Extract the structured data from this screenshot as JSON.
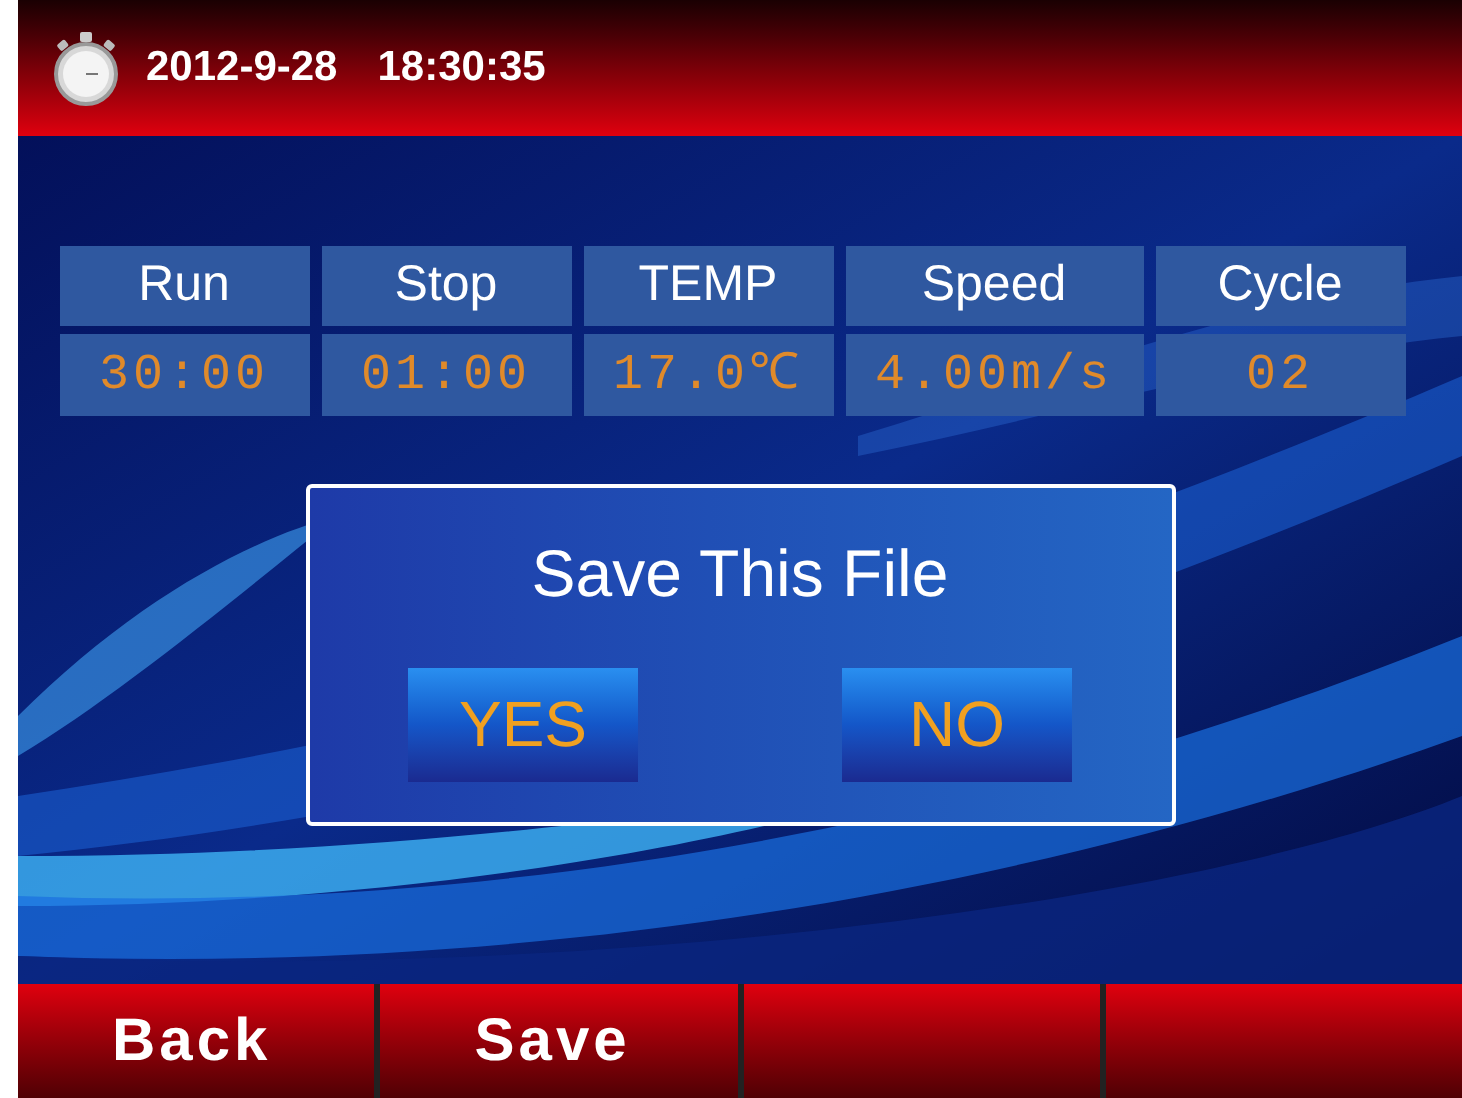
{
  "status_bar": {
    "date": "2012-9-28",
    "time": "18:30:35"
  },
  "table": {
    "columns": [
      {
        "heading": "Run",
        "value": "30:00"
      },
      {
        "heading": "Stop",
        "value": "01:00"
      },
      {
        "heading": "TEMP",
        "value": "17.0℃"
      },
      {
        "heading": "Speed",
        "value": "4.00m/s"
      },
      {
        "heading": "Cycle",
        "value": "02"
      }
    ]
  },
  "dialog": {
    "title": "Save This File",
    "buttons": [
      "YES",
      "NO"
    ]
  },
  "footer": {
    "buttons": [
      {
        "kind": "labelled",
        "label": "Back"
      },
      {
        "kind": "labelled",
        "label": "Save"
      },
      {
        "kind": "blank"
      },
      {
        "kind": "blank"
      }
    ]
  }
}
